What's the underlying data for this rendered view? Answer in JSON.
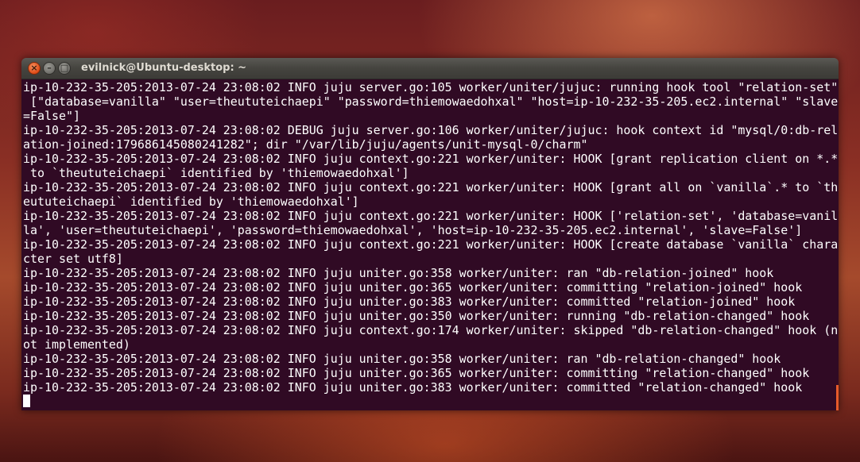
{
  "window": {
    "title": "evilnick@Ubuntu-desktop: ~",
    "close_glyph": "×",
    "minimize_glyph": "–",
    "maximize_glyph": "□"
  },
  "terminal": {
    "lines": [
      "ip-10-232-35-205:2013-07-24 23:08:02 INFO juju server.go:105 worker/uniter/jujuc: running hook tool \"relation-set\"",
      " [\"database=vanilla\" \"user=theututeichaepi\" \"password=thiemowaedohxal\" \"host=ip-10-232-35-205.ec2.internal\" \"slave",
      "=False\"]",
      "ip-10-232-35-205:2013-07-24 23:08:02 DEBUG juju server.go:106 worker/uniter/jujuc: hook context id \"mysql/0:db-rel",
      "ation-joined:179686145080241282\"; dir \"/var/lib/juju/agents/unit-mysql-0/charm\"",
      "ip-10-232-35-205:2013-07-24 23:08:02 INFO juju context.go:221 worker/uniter: HOOK [grant replication client on *.*",
      " to `theututeichaepi` identified by 'thiemowaedohxal']",
      "ip-10-232-35-205:2013-07-24 23:08:02 INFO juju context.go:221 worker/uniter: HOOK [grant all on `vanilla`.* to `th",
      "eututeichaepi` identified by 'thiemowaedohxal']",
      "ip-10-232-35-205:2013-07-24 23:08:02 INFO juju context.go:221 worker/uniter: HOOK ['relation-set', 'database=vanil",
      "la', 'user=theututeichaepi', 'password=thiemowaedohxal', 'host=ip-10-232-35-205.ec2.internal', 'slave=False']",
      "ip-10-232-35-205:2013-07-24 23:08:02 INFO juju context.go:221 worker/uniter: HOOK [create database `vanilla` chara",
      "cter set utf8]",
      "ip-10-232-35-205:2013-07-24 23:08:02 INFO juju uniter.go:358 worker/uniter: ran \"db-relation-joined\" hook",
      "ip-10-232-35-205:2013-07-24 23:08:02 INFO juju uniter.go:365 worker/uniter: committing \"relation-joined\" hook",
      "ip-10-232-35-205:2013-07-24 23:08:02 INFO juju uniter.go:383 worker/uniter: committed \"relation-joined\" hook",
      "ip-10-232-35-205:2013-07-24 23:08:02 INFO juju uniter.go:350 worker/uniter: running \"db-relation-changed\" hook",
      "ip-10-232-35-205:2013-07-24 23:08:02 INFO juju context.go:174 worker/uniter: skipped \"db-relation-changed\" hook (n",
      "ot implemented)",
      "ip-10-232-35-205:2013-07-24 23:08:02 INFO juju uniter.go:358 worker/uniter: ran \"db-relation-changed\" hook",
      "ip-10-232-35-205:2013-07-24 23:08:02 INFO juju uniter.go:365 worker/uniter: committing \"relation-changed\" hook",
      "ip-10-232-35-205:2013-07-24 23:08:02 INFO juju uniter.go:383 worker/uniter: committed \"relation-changed\" hook"
    ],
    "prompt": ""
  },
  "colors": {
    "terminal_bg": "#300a24",
    "terminal_fg": "#ffffff",
    "titlebar": "#3c3b37",
    "close_button": "#df4a16",
    "scrollbar": "#e65a2a"
  },
  "icons": {
    "close": "close-icon",
    "minimize": "minimize-icon",
    "maximize": "maximize-icon"
  }
}
